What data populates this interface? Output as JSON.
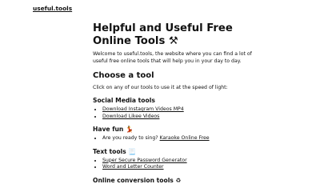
{
  "header": {
    "brand": "useful.tools"
  },
  "main": {
    "title": "Helpful and Useful Free Online Tools",
    "title_emoji": "⚒",
    "intro": "Welcome to useful.tools, the website where you can find a lot of useful free online tools that will help you in your day to day.",
    "choose_heading": "Choose a tool",
    "choose_text": "Click on any of our tools to use it at the speed of light:",
    "sections": {
      "social": {
        "heading": "Social Media tools",
        "links": [
          "Download Instagram Videos MP4",
          "Download Likee Videos"
        ]
      },
      "fun": {
        "heading": "Have fun",
        "emoji": "💃",
        "text": "Are you ready to sing?",
        "link": "Karaoke Online Free"
      },
      "text": {
        "heading": "Text tools",
        "emoji": "📃",
        "links": [
          "Super Secure Password Generator",
          "Word and Letter Counter"
        ]
      },
      "conversion": {
        "heading": "Online conversion tools",
        "emoji": "♻"
      }
    }
  }
}
